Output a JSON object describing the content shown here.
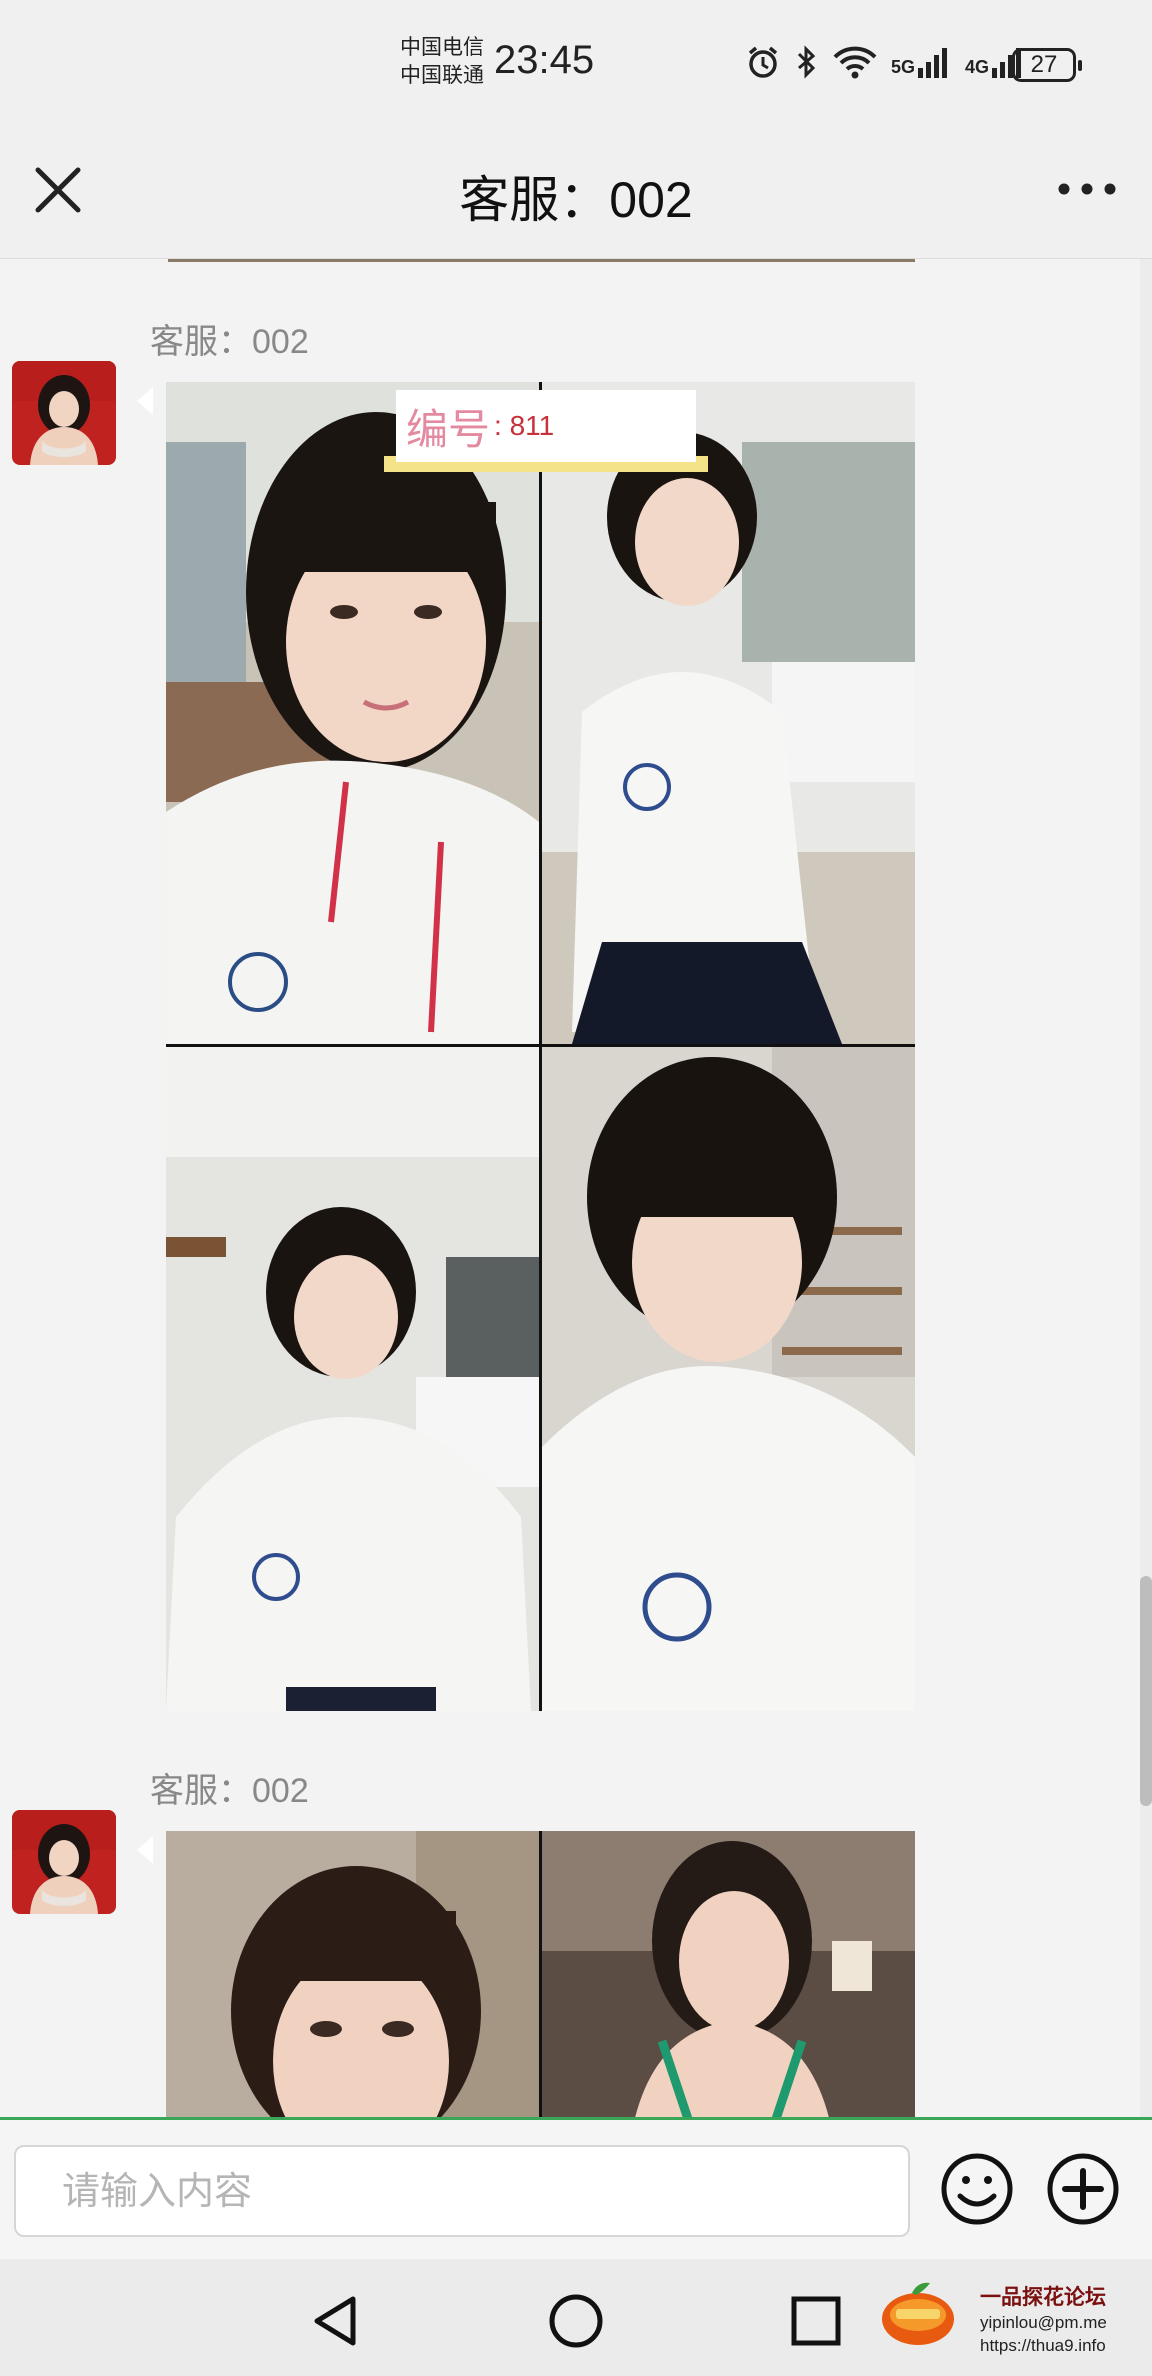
{
  "status_bar": {
    "carrier_1": "中国电信",
    "carrier_2": "中国联通",
    "time": "23:45",
    "network_1": "5G",
    "network_2": "4G",
    "battery": "27",
    "icons": [
      "alarm-icon",
      "bluetooth-icon",
      "wifi-icon",
      "signal-icon",
      "signal-icon"
    ]
  },
  "header": {
    "title": "客服：002",
    "left_icon": "close-icon",
    "right_icon": "more-icon"
  },
  "messages": [
    {
      "sender": "客服：002",
      "image_label_prefix": "编号",
      "image_label_value": ": 811"
    },
    {
      "sender": "客服：002"
    }
  ],
  "composer": {
    "placeholder": "请输入内容",
    "emoji_icon": "emoji-icon",
    "plus_icon": "plus-circle-icon"
  },
  "system_nav": {
    "icons": [
      "back-icon",
      "home-icon",
      "recents-icon"
    ]
  },
  "watermark": {
    "title": "一品探花论坛",
    "line_1": "yipinlou@pm.me",
    "line_2": "https://thua9.info"
  },
  "colors": {
    "accent_green": "#3aa657",
    "label_pink": "#e38aa0"
  }
}
